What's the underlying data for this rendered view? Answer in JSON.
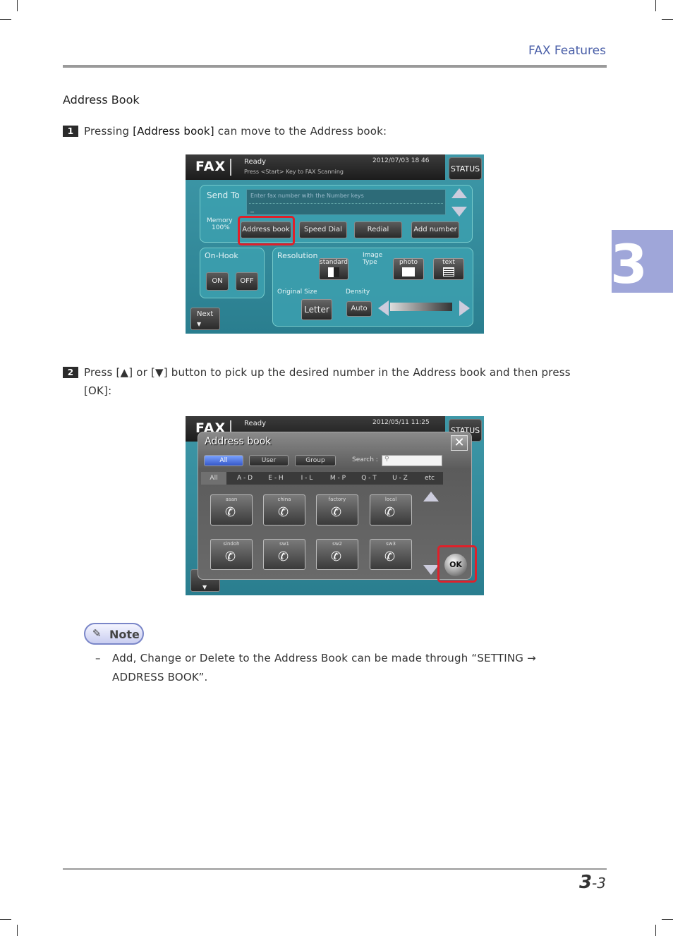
{
  "header": {
    "title": "FAX Features"
  },
  "section_title": "Address Book",
  "steps": [
    {
      "num": "1",
      "pre": "Pressing ",
      "highlight": "[Address book]",
      "post": " can move to the Address book:"
    },
    {
      "num": "2",
      "line1": "Press [▲] or [▼] button to pick up the desired number in the Address book and then press",
      "line2": "[OK]:"
    }
  ],
  "chapter_tab": "3",
  "screen1": {
    "fax": "FAX",
    "ready": "Ready",
    "hint": "Press <Start> Key to FAX Scanning",
    "datetime": "2012/07/03 18 46",
    "status": "STATUS",
    "send_to": "Send To",
    "placeholder": "Enter fax number with the Number keys",
    "cursor": "_",
    "memory": "Memory",
    "memory_pct": "100%",
    "buttons": {
      "address_book": "Address book",
      "speed_dial": "Speed Dial",
      "redial": "Redial",
      "add_number": "Add number"
    },
    "on_hook": "On-Hook",
    "on": "ON",
    "off": "OFF",
    "next": "Next",
    "resolution": "Resolution",
    "standard": "standard",
    "image_type": "Image",
    "image_type2": "Type",
    "photo": "photo",
    "text": "text",
    "original_size": "Original Size",
    "letter": "Letter",
    "density": "Density",
    "auto": "Auto"
  },
  "screen2": {
    "fax": "FAX",
    "ready": "Ready",
    "datetime": "2012/05/11 11:25",
    "status": "STATUS",
    "title": "Address book",
    "close": "✕",
    "groups": [
      "All",
      "User",
      "Group"
    ],
    "search_label": "Search :",
    "tabs": [
      "All",
      "A - D",
      "E - H",
      "I - L",
      "M - P",
      "Q - T",
      "U - Z",
      "etc"
    ],
    "entries": [
      "asan",
      "china",
      "factory",
      "local",
      "sindoh",
      "sw1",
      "sw2",
      "sw3"
    ],
    "ok": "OK"
  },
  "note": {
    "label": "Note",
    "dash": "–",
    "line1": "Add, Change or Delete to the Address Book can be made through “SETTING →",
    "line2": "ADDRESS BOOK”."
  },
  "footer": {
    "page_chapter": "3",
    "page_sep": "-",
    "page_num": "3"
  }
}
